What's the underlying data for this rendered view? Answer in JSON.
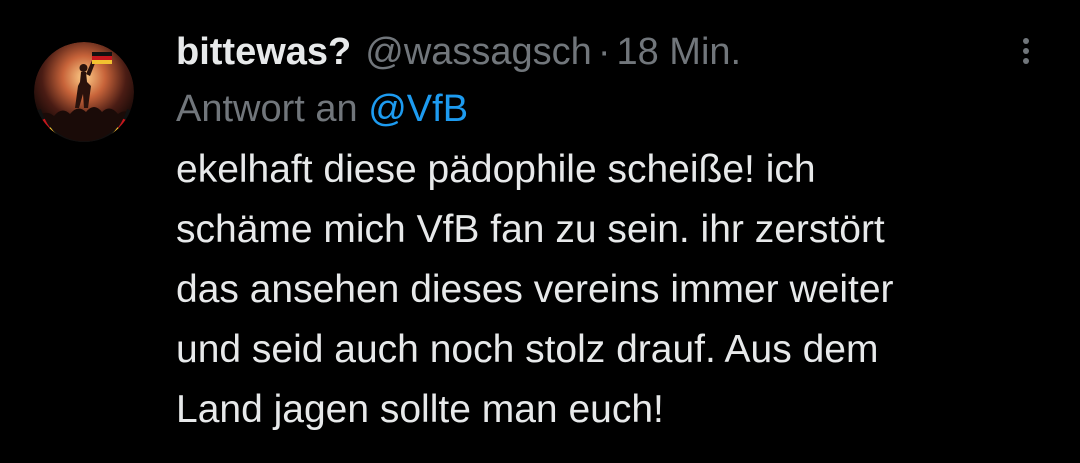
{
  "tweet": {
    "author": {
      "display_name": "bittewas?",
      "handle": "@wassagsch",
      "avatar_icon": "profile-avatar"
    },
    "separator": "·",
    "timestamp": "18 Min.",
    "more_icon": "more-vertical-icon",
    "reply": {
      "prefix": "Antwort an",
      "target": "@VfB"
    },
    "text_lines": [
      "ekelhaft diese pädophile scheiße! ich",
      "schäme mich VfB fan zu sein. ihr zerstört",
      "das ansehen dieses vereins immer weiter",
      "und seid auch noch stolz drauf. Aus dem",
      "Land jagen sollte man euch!"
    ]
  },
  "colors": {
    "background": "#000000",
    "primary_text": "#e7e9ea",
    "secondary_text": "#71767b",
    "link": "#1d9bf0"
  }
}
